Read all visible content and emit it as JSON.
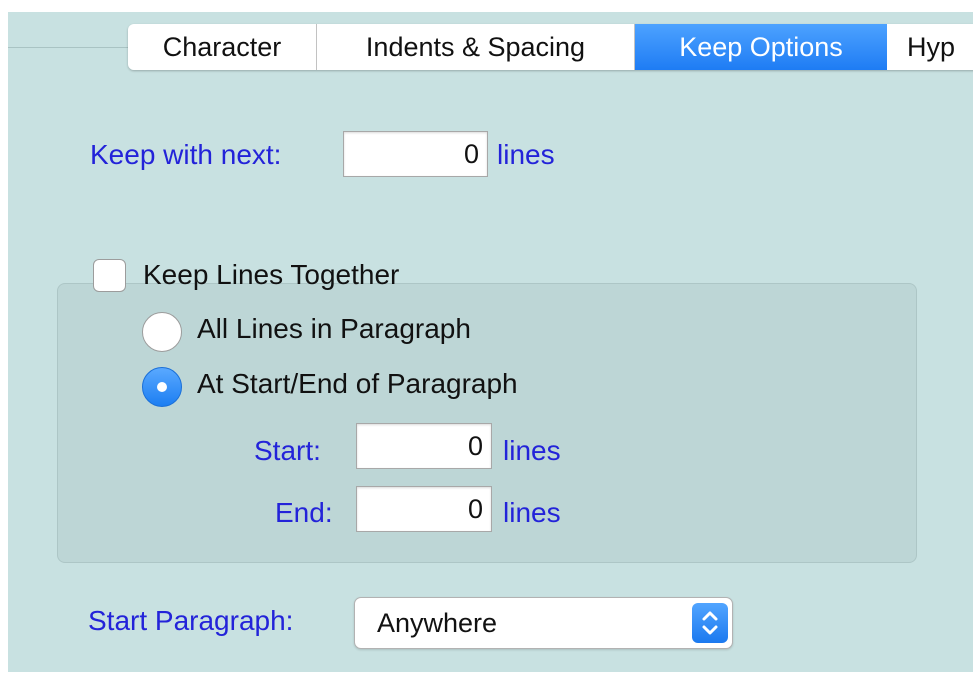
{
  "tabs": {
    "items": [
      {
        "label": "Character"
      },
      {
        "label": "Indents & Spacing"
      },
      {
        "label": "Keep Options"
      },
      {
        "label": "Hyp"
      }
    ],
    "active_index": 2
  },
  "keep_with_next": {
    "label": "Keep with next:",
    "value": "0",
    "unit": "lines"
  },
  "keep_lines_together": {
    "label": "Keep Lines Together",
    "checked": false,
    "options": [
      {
        "label": "All Lines in Paragraph",
        "selected": false
      },
      {
        "label": "At Start/End of Paragraph",
        "selected": true
      }
    ],
    "start": {
      "label": "Start:",
      "value": "0",
      "unit": "lines"
    },
    "end": {
      "label": "End:",
      "value": "0",
      "unit": "lines"
    }
  },
  "start_paragraph": {
    "label": "Start Paragraph:",
    "value": "Anywhere"
  },
  "colors": {
    "panel_bg": "#c8e1e1",
    "group_bg": "#bdd6d6",
    "label_blue": "#2323d9",
    "accent_blue": "#1e7cf4"
  },
  "icons": {
    "select_arrows": "up-down-chevron-icon",
    "radio_dot": "radio-dot-icon"
  }
}
